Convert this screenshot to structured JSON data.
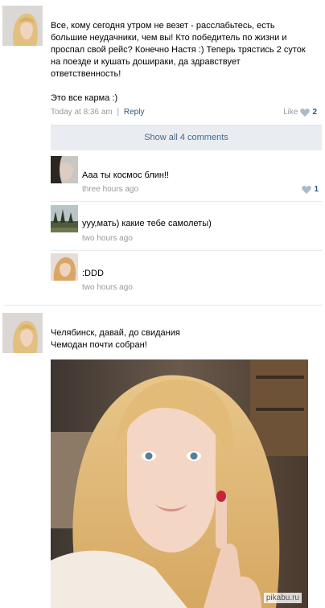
{
  "post1": {
    "text_lines": [
      "Все, кому сегодня утром не везет - расслабьтесь, есть",
      "большие неудачники, чем вы! Кто победитель по жизни и",
      "проспал свой рейс? Конечно Настя :) Теперь трястись 2 суток",
      "на поезде и кушать дошираки, да здравствует",
      "ответственность!"
    ],
    "tail": "Это все карма :)",
    "time": "Today at 8:36 am",
    "separator": "|",
    "reply": "Reply",
    "like_label": "Like",
    "like_count": "2",
    "show_comments": "Show all 4 comments"
  },
  "comments": [
    {
      "text": "Ааа ты космос блин!!",
      "time": "three hours ago",
      "like_count": "1"
    },
    {
      "text": "ууу,мать) какие тебе самолеты)",
      "time": "two hours ago"
    },
    {
      "text": ":DDD",
      "time": "two hours ago"
    }
  ],
  "post2": {
    "text_lines": [
      "Челябинск, давай, до свидания",
      "Чемодан почти собран!"
    ]
  },
  "watermark": "pikabu.ru",
  "colors": {
    "link": "#2b587a",
    "meta": "#999999",
    "panel": "#e9edf1",
    "accent": "#45688e"
  }
}
